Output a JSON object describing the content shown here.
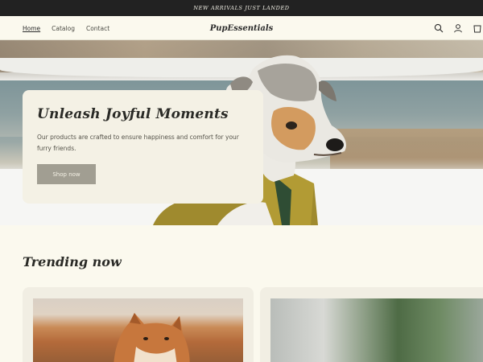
{
  "announcement": {
    "text": "NEW ARRIVALS JUST LANDED"
  },
  "header": {
    "nav": [
      "Home",
      "Catalog",
      "Contact"
    ],
    "brand": "PupEssentials",
    "icons": [
      "search-icon",
      "account-icon",
      "cart-icon"
    ]
  },
  "hero": {
    "title": "Unleash Joyful Moments",
    "description": "Our products are crafted to ensure happiness and comfort for your furry friends.",
    "button_label": "Shop now"
  },
  "trending": {
    "title": "Trending now"
  },
  "colors": {
    "announce_bg": "#222222",
    "page_bg": "#fbf9ee",
    "button_bg": "#a19e92",
    "card_bg": "#f4f1e5"
  }
}
